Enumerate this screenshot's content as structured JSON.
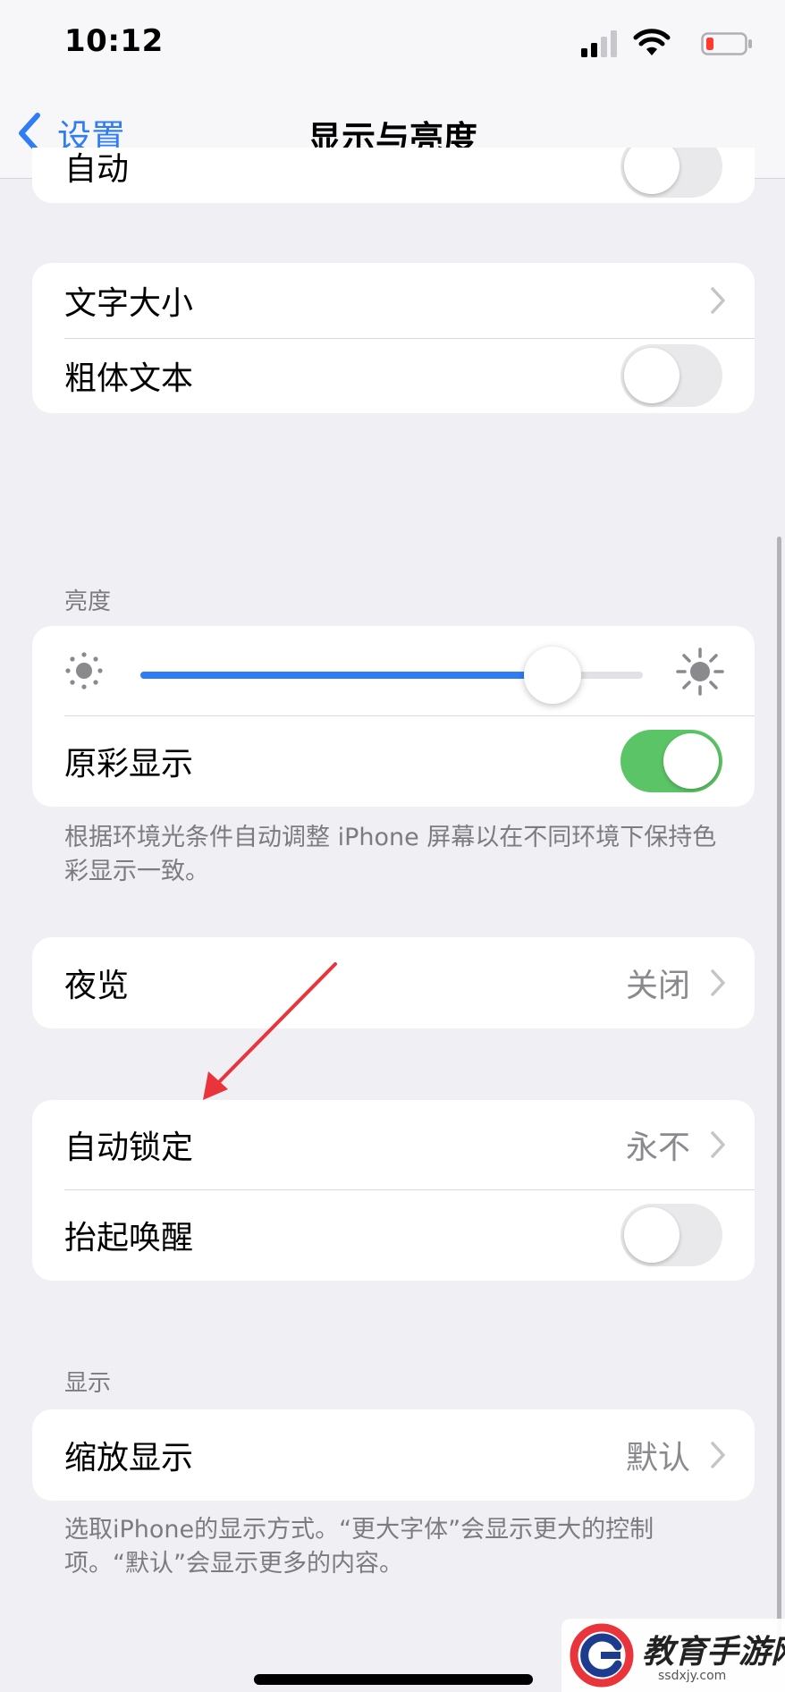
{
  "status_bar": {
    "time": "10:12",
    "icons": [
      "signal-icon",
      "wifi-icon",
      "battery-icon"
    ],
    "battery_color": "#ff3b30"
  },
  "nav": {
    "back_label": "设置",
    "title": "显示与亮度"
  },
  "appearance": {
    "auto_label": "自动",
    "auto_on": false
  },
  "text": {
    "text_size_label": "文字大小",
    "bold_text_label": "粗体文本",
    "bold_text_on": false
  },
  "brightness": {
    "header": "亮度",
    "level": 0.82,
    "true_tone_label": "原彩显示",
    "true_tone_on": true,
    "footnote": "根据环境光条件自动调整 iPhone 屏幕以在不同环境下保持色彩显示一致。"
  },
  "night_shift": {
    "label": "夜览",
    "value": "关闭"
  },
  "lock": {
    "auto_lock_label": "自动锁定",
    "auto_lock_value": "永不",
    "raise_to_wake_label": "抬起唤醒",
    "raise_to_wake_on": false
  },
  "display": {
    "header": "显示",
    "zoom_label": "缩放显示",
    "zoom_value": "默认",
    "footnote": "选取iPhone的显示方式。“更大字体”会显示更大的控制项。“默认”会显示更多的内容。"
  },
  "colors": {
    "accent": "#2f7cf6",
    "toggle_on": "#5bc466",
    "background": "#efeff4",
    "annotation": "#e8343a"
  },
  "watermark": {
    "text": "教育手游网",
    "url": "ssdxjy.com"
  }
}
